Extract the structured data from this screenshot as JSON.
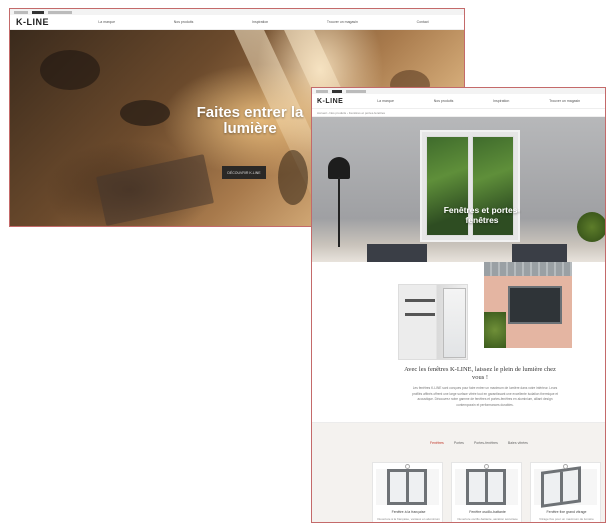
{
  "window1": {
    "logo": "K-LINE",
    "nav": [
      "La marque",
      "Nos produits",
      "Inspiration",
      "Trouver un magasin",
      "Contact"
    ],
    "hero": {
      "title": "Faites entrer la lumière",
      "button": "DÉCOUVRIR K-LINE"
    }
  },
  "window2": {
    "logo": "K-LINE",
    "nav": [
      "La marque",
      "Nos produits",
      "Inspiration",
      "Trouver un magasin"
    ],
    "breadcrumb": "Accueil › Nos produits › Fenêtres et portes-fenêtres",
    "hero": {
      "title": "Fenêtres et portes-fenêtres"
    },
    "intro": {
      "heading": "Avec les fenêtres K-LINE, laissez le plein de lumière chez vous !",
      "text": "Les fenêtres K-LINE sont conçues pour faire entrer un maximum de lumière dans votre intérieur. Leurs profilés affinés offrent une large surface vitrée tout en garantissant une excellente isolation thermique et acoustique. Découvrez notre gamme de fenêtres et portes-fenêtres en aluminium, alliant design contemporain et performances durables."
    },
    "tabs": [
      "Fenêtres",
      "Portes",
      "Portes-fenêtres",
      "Baies vitrées"
    ],
    "active_tab": 0,
    "cards": [
      {
        "title": "Fenêtre à la française",
        "sub": "Ouverture à la française, vantaux en aluminium"
      },
      {
        "title": "Fenêtre oscillo-battante",
        "sub": "Ouverture oscillo-battante, aération sécurisée"
      },
      {
        "title": "Fenêtre fixe grand vitrage",
        "sub": "Vitrage fixe pour un maximum de lumière"
      }
    ]
  },
  "colors": {
    "frame_border": "#c46a6a",
    "active_tab": "#c0392b"
  }
}
